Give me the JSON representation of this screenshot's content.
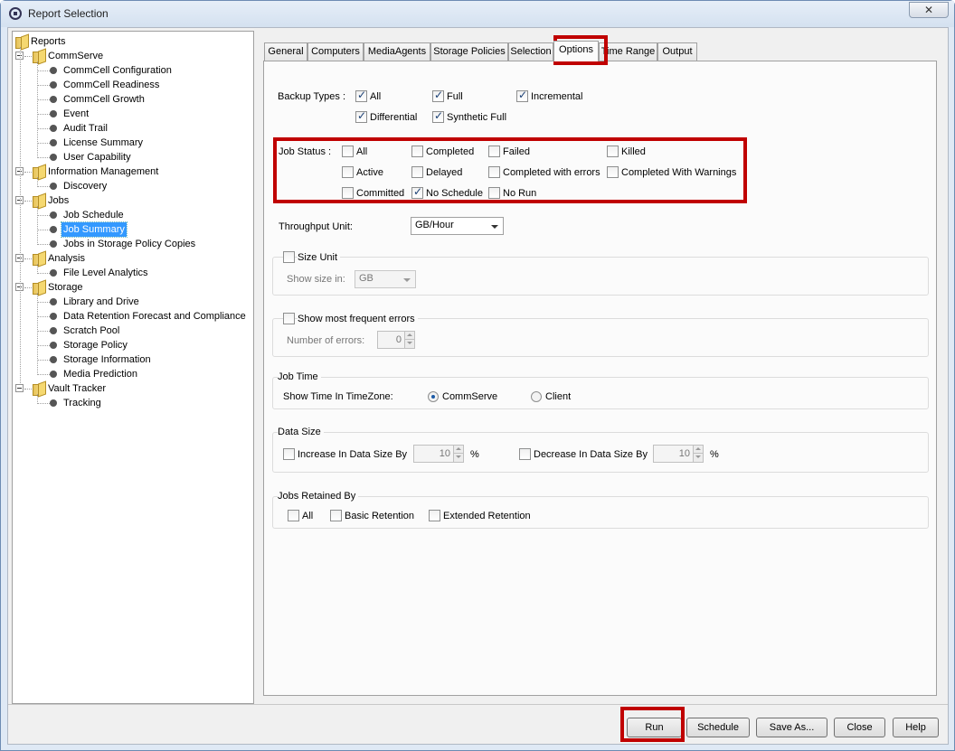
{
  "window": {
    "title": "Report Selection",
    "close_glyph": "✕"
  },
  "tree": {
    "root": "Reports",
    "groups": [
      {
        "label": "CommServe",
        "items": [
          "CommCell Configuration",
          "CommCell Readiness",
          "CommCell Growth",
          "Event",
          "Audit Trail",
          "License Summary",
          "User Capability"
        ]
      },
      {
        "label": "Information Management",
        "items": [
          "Discovery"
        ]
      },
      {
        "label": "Jobs",
        "items": [
          "Job Schedule",
          "Job Summary",
          "Jobs in Storage Policy Copies"
        ]
      },
      {
        "label": "Analysis",
        "items": [
          "File Level Analytics"
        ]
      },
      {
        "label": "Storage",
        "items": [
          "Library and Drive",
          "Data Retention Forecast and Compliance",
          "Scratch Pool",
          "Storage Policy",
          "Storage Information",
          "Media Prediction"
        ]
      },
      {
        "label": "Vault Tracker",
        "items": [
          "Tracking"
        ]
      }
    ],
    "selected": "Job Summary"
  },
  "tabs": [
    "General",
    "Computers",
    "MediaAgents",
    "Storage Policies",
    "Selection",
    "Options",
    "Time Range",
    "Output"
  ],
  "active_tab": "Options",
  "options": {
    "backup_types": {
      "label": "Backup Types :",
      "items": [
        {
          "label": "All",
          "checked": true
        },
        {
          "label": "Full",
          "checked": true
        },
        {
          "label": "Incremental",
          "checked": true
        },
        {
          "label": "Differential",
          "checked": true
        },
        {
          "label": "Synthetic Full",
          "checked": true
        }
      ]
    },
    "job_status": {
      "label": "Job Status :",
      "items": [
        {
          "label": "All",
          "checked": false
        },
        {
          "label": "Completed",
          "checked": false
        },
        {
          "label": "Failed",
          "checked": false
        },
        {
          "label": "Killed",
          "checked": false
        },
        {
          "label": "Active",
          "checked": false
        },
        {
          "label": "Delayed",
          "checked": false
        },
        {
          "label": "Completed with errors",
          "checked": false
        },
        {
          "label": "Completed With Warnings",
          "checked": false
        },
        {
          "label": "Committed",
          "checked": false
        },
        {
          "label": "No Schedule",
          "checked": true
        },
        {
          "label": "No Run",
          "checked": false
        }
      ]
    },
    "throughput": {
      "label": "Throughput Unit:",
      "value": "GB/Hour"
    },
    "size_unit": {
      "label": "Size Unit",
      "checked": false,
      "show_label": "Show size in:",
      "value": "GB"
    },
    "frequent_errors": {
      "label": "Show most frequent errors",
      "checked": false,
      "count_label": "Number of errors:",
      "value": "0"
    },
    "job_time": {
      "title": "Job Time",
      "label": "Show Time In TimeZone:",
      "options": [
        "CommServe",
        "Client"
      ],
      "selected": "CommServe"
    },
    "data_size": {
      "title": "Data Size",
      "increase_label": "Increase In Data Size By",
      "increase_value": "10",
      "increase_checked": false,
      "decrease_label": "Decrease In Data Size By",
      "decrease_value": "10",
      "decrease_checked": false,
      "unit": "%"
    },
    "retained": {
      "title": "Jobs Retained By",
      "items": [
        {
          "label": "All",
          "checked": false
        },
        {
          "label": "Basic Retention",
          "checked": false
        },
        {
          "label": "Extended Retention",
          "checked": false
        }
      ]
    }
  },
  "buttons": {
    "run": "Run",
    "schedule": "Schedule",
    "save_as": "Save As...",
    "close": "Close",
    "help": "Help"
  },
  "colors": {
    "highlight": "#c00000",
    "selection": "#3399ff"
  }
}
